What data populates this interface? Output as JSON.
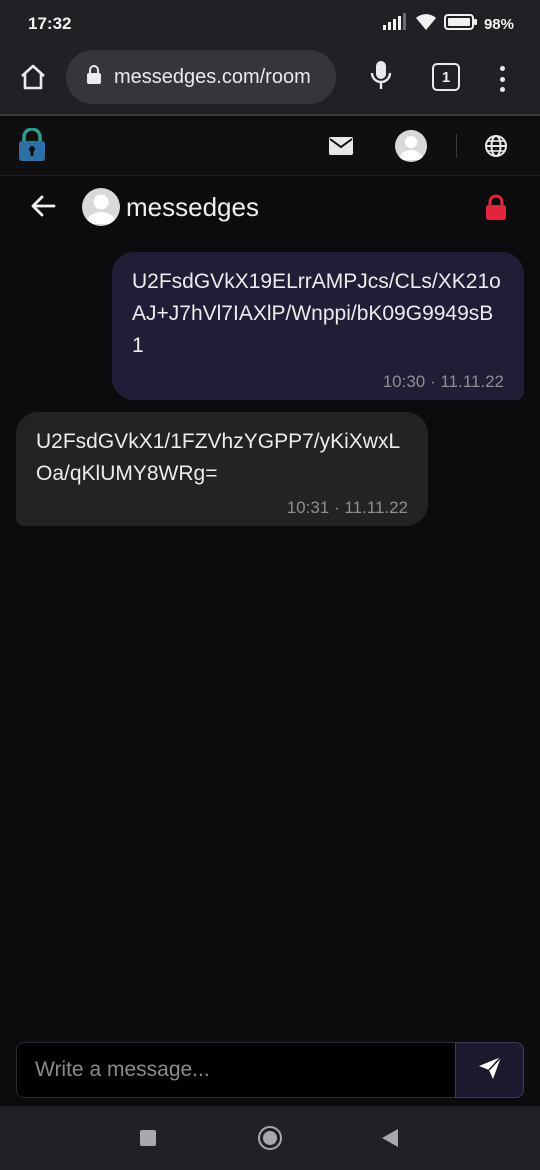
{
  "status_bar": {
    "time": "17:32",
    "battery": "98%",
    "icons": [
      "signal-icon",
      "wifi-icon",
      "battery-icon"
    ]
  },
  "browser": {
    "url": "messedges.com/room",
    "tab_count": "1",
    "icons": [
      "home-icon",
      "lock-icon",
      "mic-icon",
      "tabs-icon",
      "more-vert-icon"
    ]
  },
  "app_header": {
    "icons": [
      "app-lock-logo-icon",
      "mail-icon",
      "avatar-icon",
      "globe-icon"
    ]
  },
  "chat": {
    "title": "messedges",
    "icons": [
      "back-arrow-icon",
      "contact-avatar-icon",
      "lock-icon"
    ],
    "accent_color": "#e0253d"
  },
  "messages": [
    {
      "direction": "sent",
      "text": "U2FsdGVkX19ELrrAMPJcs/CLs/XK21oAJ+J7hVl7IAXlP/Wnppi/bK09G9949sB1",
      "time": "10:30 · 11.11.22",
      "bubble_color": "#221d37"
    },
    {
      "direction": "received",
      "text": "U2FsdGVkX1/1FZVhzYGPP7/yKiXwxLOa/qKlUMY8WRg=",
      "time": "10:31 · 11.11.22",
      "bubble_color": "#232325"
    }
  ],
  "composer": {
    "placeholder": "Write a message...",
    "value": "",
    "send_icon": "send-icon"
  },
  "nav_bar": {
    "icons": [
      "recents-icon",
      "home-icon",
      "back-icon"
    ]
  }
}
